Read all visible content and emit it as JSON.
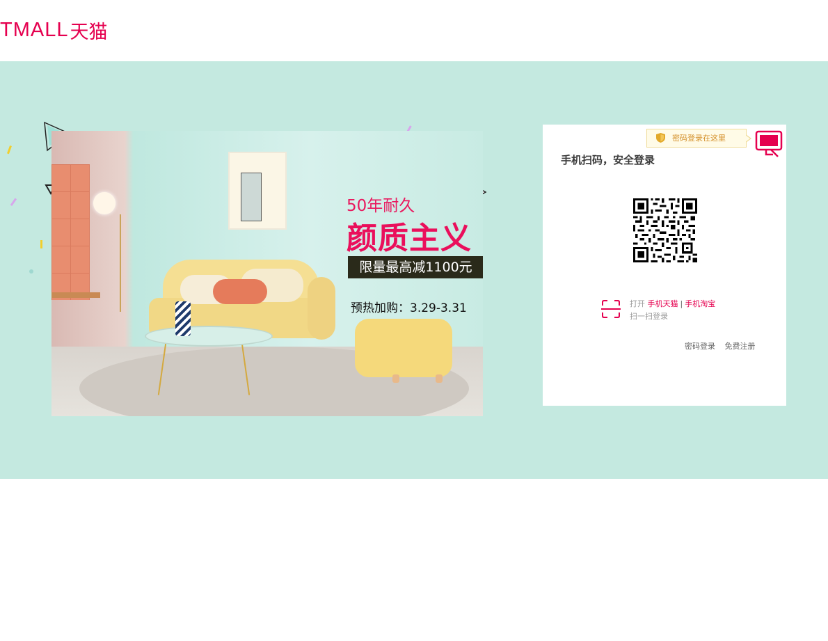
{
  "header": {
    "logo_latin": "TMALL",
    "logo_cn": "天猫"
  },
  "banner": {
    "background_color": "#c4e9e0",
    "ad": {
      "years_text": "50年耐久",
      "main_text": "颜质主义",
      "discount_text": "限量最高减1100元",
      "date_text": "预热加购：3.29-3.31"
    }
  },
  "login": {
    "password_tip": "密码登录在这里",
    "title": "手机扫码，安全登录",
    "scan": {
      "open": "打开",
      "app1": "手机天猫",
      "separator": "|",
      "app2": "手机淘宝",
      "line2": "扫一扫登录"
    },
    "links": {
      "password_login": "密码登录",
      "register": "免费注册"
    }
  },
  "colors": {
    "brand": "#e5004f",
    "tip_bg": "#fffbe7",
    "tip_text": "#d4902a"
  }
}
